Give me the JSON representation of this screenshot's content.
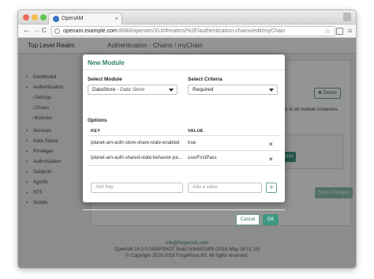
{
  "browser": {
    "tab_title": "OpenAM",
    "tab_close": "×",
    "url_host": "openam.example.com",
    "url_rest": ":8080/openam/XUI/#realms/%2F/authentication-chains/edit/myChain",
    "nav_back": "←",
    "nav_forward": "→",
    "reload": "C",
    "bookmark": "☆",
    "menu": "≡"
  },
  "header": {
    "realm": "Top Level Realm",
    "breadcrumb": "Authentication - Chains / myChain"
  },
  "sidebar": {
    "items": [
      {
        "icon": "▪",
        "label": "Dashboard"
      },
      {
        "icon": "▪",
        "label": "Authentication"
      },
      {
        "icon": "▪",
        "label": "Services"
      },
      {
        "icon": "▪",
        "label": "Data Stores"
      },
      {
        "icon": "▪",
        "label": "Privileges"
      },
      {
        "icon": "▪",
        "label": "Authorization"
      },
      {
        "icon": "▪",
        "label": "Subjects"
      },
      {
        "icon": "▪",
        "label": "Agents"
      },
      {
        "icon": "▪",
        "label": "STS"
      },
      {
        "icon": "▪",
        "label": "Scripts"
      }
    ],
    "sub_items": [
      {
        "marker": "›",
        "label": "Settings"
      },
      {
        "marker": "›",
        "label": "Chains"
      },
      {
        "marker": "›",
        "label": "Modules"
      }
    ]
  },
  "background": {
    "delete_label": "✖ Delete",
    "info_text": "als to all module instances.",
    "module_label": "dule",
    "save_label": "Save Changes"
  },
  "footer": {
    "email": "info@forgerock.com",
    "version": "OpenAM 14.0.0-SNAPSHOT Build 0c94d02d09 (2016-May-26 01:18)",
    "copyright": "© Copyright 2010-2016 ForgeRock AS. All rights reserved."
  },
  "modal": {
    "title": "New Module",
    "select_module_label": "Select Module",
    "select_module_value": "DataStore",
    "select_module_sub": " - Data Store",
    "select_criteria_label": "Select Criteria",
    "select_criteria_value": "Required",
    "options_label": "Options",
    "key_header": "KEY",
    "value_header": "VALUE",
    "rows": [
      {
        "key": "iplanet-am-auth-store-share-state-enabled",
        "value": "true",
        "remove": "×"
      },
      {
        "key": "iplanet-am-auth-shared-state-behavior-pa...",
        "value": "userFirstPass",
        "remove": "×"
      }
    ],
    "add_key_placeholder": "Add Key",
    "add_value_placeholder": "Add a value",
    "add_button": "+",
    "cancel_label": "Cancel",
    "ok_label": "OK"
  }
}
